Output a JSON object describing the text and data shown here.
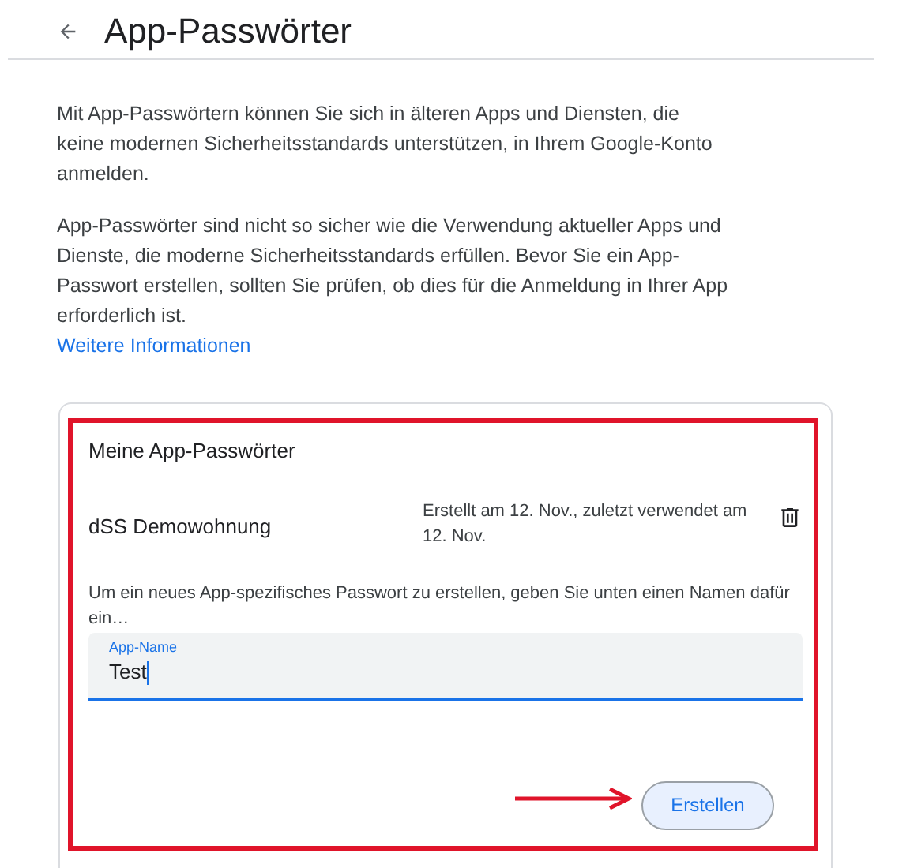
{
  "header": {
    "title": "App-Passwörter"
  },
  "intro": [
    "Mit App-Passwörtern können Sie sich in älteren Apps und Diensten, die keine modernen Sicherheitsstandards unterstützen, in Ihrem Google-Konto anmelden.",
    "App-Passwörter sind nicht so sicher wie die Verwendung aktueller Apps und Dienste, die moderne Sicherheitsstandards erfüllen. Bevor Sie ein App-Passwort erstellen, sollten Sie prüfen, ob dies für die Anmeldung in Ihrer App erforderlich ist."
  ],
  "more_link": "Weitere Informationen",
  "card": {
    "title": "Meine App-Passwörter",
    "passwords": [
      {
        "name": "dSS Demowohnung",
        "info": "Erstellt am 12. Nov., zuletzt verwendet am 12. Nov."
      }
    ],
    "hint": "Um ein neues App-spezifisches Passwort zu erstellen, geben Sie unten einen Namen dafür ein…",
    "field": {
      "label": "App-Name",
      "value": "Test",
      "focused": true
    },
    "button": "Erstellen"
  },
  "annotations": {
    "highlight_frame": true,
    "arrow": true
  }
}
